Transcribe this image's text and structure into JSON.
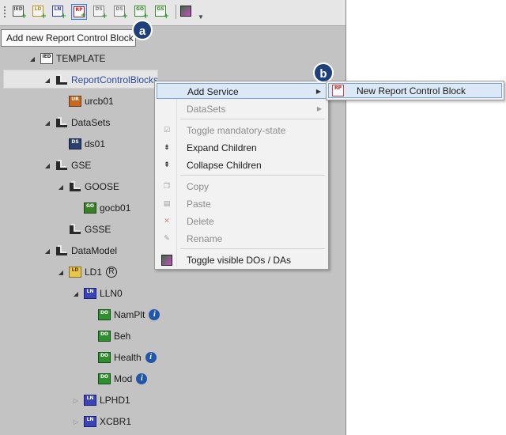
{
  "toolbar": {
    "buttons": [
      {
        "id": "add-ied",
        "icon": "ied-icon",
        "label": "IED",
        "color": "#555555",
        "active": false
      },
      {
        "id": "add-ld",
        "icon": "logical-device-icon",
        "label": "LD",
        "color": "#b8921e",
        "active": false
      },
      {
        "id": "add-ln",
        "icon": "logical-node-icon",
        "label": "LN",
        "color": "#3a43b8",
        "active": false
      },
      {
        "id": "add-rp",
        "icon": "report-control-block-icon",
        "label": "RP",
        "color": "#b22222",
        "active": true
      },
      {
        "id": "add-ds",
        "icon": "dataset-icon",
        "label": "DS",
        "color": "#808080",
        "active": false
      },
      {
        "id": "add-ds2",
        "icon": "dataset-icon",
        "label": "DS",
        "color": "#808080",
        "active": false
      },
      {
        "id": "add-go",
        "icon": "goose-icon",
        "label": "GO",
        "color": "#3a8a2a",
        "active": false
      },
      {
        "id": "add-gs",
        "icon": "gsse-icon",
        "label": "GS",
        "color": "#3a8a2a",
        "active": false
      },
      {
        "id": "toggle-visible",
        "icon": "toggle-visible-icon",
        "label": "",
        "color": "#3d6e3d",
        "active": false
      }
    ]
  },
  "tooltip": "Add new Report Control Block",
  "callouts": {
    "a": "a",
    "b": "b"
  },
  "tree": [
    {
      "id": "template",
      "label": "TEMPLATE",
      "icon": "ied-icon",
      "iconText": "IED",
      "expand": "open"
    },
    {
      "id": "report-control-blocks",
      "label": "ReportControlBlocks",
      "icon": "folder-icon",
      "iconText": "",
      "expand": "open",
      "selected": true,
      "linkColor": "#2b4a9a"
    },
    {
      "id": "urcb01",
      "label": "urcb01",
      "icon": "urcb-icon",
      "iconText": "UR",
      "expand": "none"
    },
    {
      "id": "datasets",
      "label": "DataSets",
      "icon": "folder-icon",
      "iconText": "",
      "expand": "open"
    },
    {
      "id": "ds01",
      "label": "ds01",
      "icon": "dataset-icon",
      "iconText": "DS",
      "expand": "none"
    },
    {
      "id": "gse",
      "label": "GSE",
      "icon": "folder-icon",
      "iconText": "",
      "expand": "open"
    },
    {
      "id": "goose",
      "label": "GOOSE",
      "icon": "folder-icon",
      "iconText": "",
      "expand": "open"
    },
    {
      "id": "gocb01",
      "label": "gocb01",
      "icon": "goose-control-block-icon",
      "iconText": "GO",
      "expand": "none"
    },
    {
      "id": "gsse",
      "label": "GSSE",
      "icon": "folder-icon",
      "iconText": "",
      "expand": "none"
    },
    {
      "id": "data-model",
      "label": "DataModel",
      "icon": "folder-icon",
      "iconText": "",
      "expand": "open"
    },
    {
      "id": "ld1",
      "label": "LD1",
      "icon": "logical-device-icon",
      "iconText": "LD",
      "expand": "open",
      "badge": "R"
    },
    {
      "id": "lln0",
      "label": "LLN0",
      "icon": "logical-node-icon",
      "iconText": "LN",
      "expand": "open-filled"
    },
    {
      "id": "namplt",
      "label": "NamPlt",
      "icon": "data-object-icon",
      "iconText": "DO",
      "expand": "none",
      "info": "i"
    },
    {
      "id": "beh",
      "label": "Beh",
      "icon": "data-object-icon",
      "iconText": "DO",
      "expand": "none"
    },
    {
      "id": "health",
      "label": "Health",
      "icon": "data-object-icon",
      "iconText": "DO",
      "expand": "none",
      "info": "i"
    },
    {
      "id": "mod",
      "label": "Mod",
      "icon": "data-object-icon",
      "iconText": "DO",
      "expand": "none",
      "info": "i"
    },
    {
      "id": "lphd1",
      "label": "LPHD1",
      "icon": "logical-node-icon",
      "iconText": "LN",
      "expand": "closed"
    },
    {
      "id": "xcbr1",
      "label": "XCBR1",
      "icon": "logical-node-icon",
      "iconText": "LN",
      "expand": "closed"
    }
  ],
  "context_menu": {
    "items": [
      {
        "id": "add-service",
        "label": "Add Service",
        "icon": "",
        "enabled": true,
        "submenu": true,
        "highlighted": true
      },
      {
        "id": "datasets",
        "label": "DataSets",
        "icon": "",
        "enabled": false,
        "submenu": true
      },
      {
        "id": "toggle-mandatory",
        "label": "Toggle mandatory-state",
        "icon": "checkbox-icon",
        "enabled": false
      },
      {
        "id": "expand-children",
        "label": "Expand Children",
        "icon": "expand-icon",
        "enabled": true
      },
      {
        "id": "collapse-children",
        "label": "Collapse Children",
        "icon": "collapse-icon",
        "enabled": true
      },
      {
        "id": "copy",
        "label": "Copy",
        "icon": "copy-icon",
        "enabled": false
      },
      {
        "id": "paste",
        "label": "Paste",
        "icon": "paste-icon",
        "enabled": false
      },
      {
        "id": "delete",
        "label": "Delete",
        "icon": "delete-icon",
        "enabled": false
      },
      {
        "id": "rename",
        "label": "Rename",
        "icon": "rename-icon",
        "enabled": false
      },
      {
        "id": "toggle-visible",
        "label": "Toggle visible DOs / DAs",
        "icon": "toggle-visible-icon",
        "enabled": true
      }
    ],
    "submenu": {
      "label": "New Report Control Block",
      "icon": "report-control-block-icon",
      "iconText": "RP"
    }
  },
  "colors": {
    "panel": "#c3c3c3",
    "toolbar": "#e6e6e6",
    "highlight": "#dbe9f7",
    "callout": "#1f3f7a"
  }
}
